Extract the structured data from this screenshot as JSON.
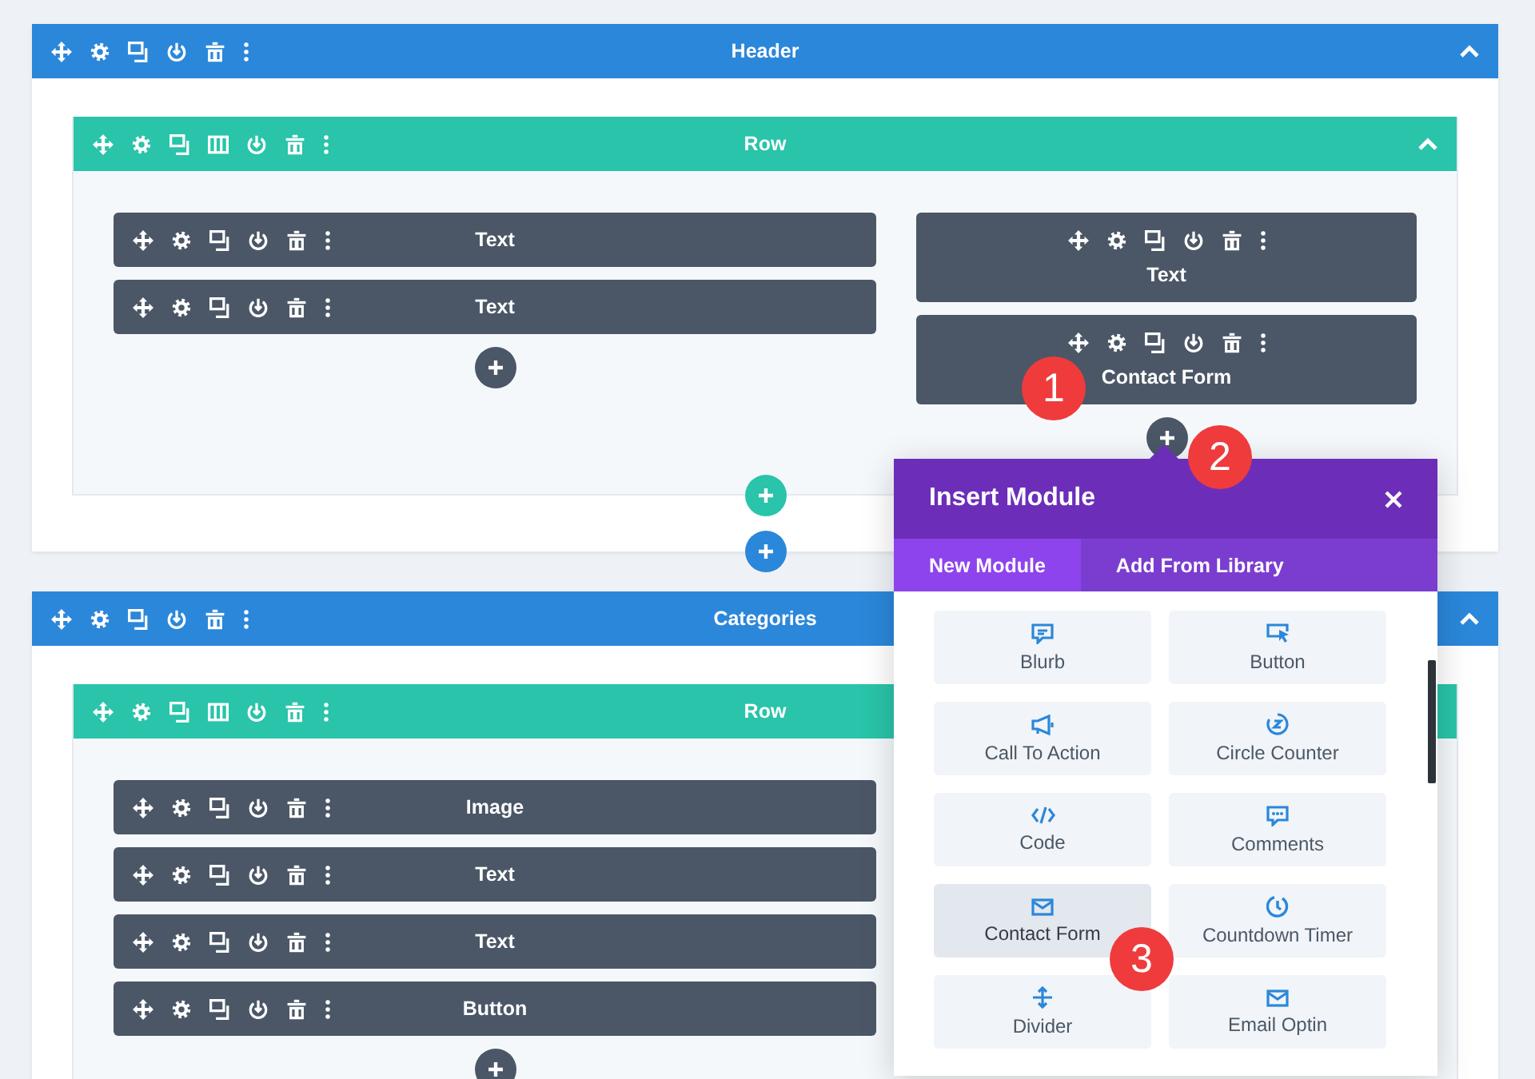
{
  "sections": [
    {
      "title": "Header",
      "rows": [
        {
          "title": "Row",
          "columns": [
            {
              "modules": [
                {
                  "title": "Text",
                  "kind": "inline"
                },
                {
                  "title": "Text",
                  "kind": "inline"
                }
              ]
            },
            {
              "modules": [
                {
                  "title": "Text",
                  "kind": "stacked"
                },
                {
                  "title": "Contact Form",
                  "kind": "stacked"
                }
              ]
            }
          ]
        }
      ]
    },
    {
      "title": "Categories",
      "rows": [
        {
          "title": "Row",
          "columns": [
            {
              "modules": [
                {
                  "title": "Image",
                  "kind": "inline"
                },
                {
                  "title": "Text",
                  "kind": "inline"
                },
                {
                  "title": "Text",
                  "kind": "inline"
                },
                {
                  "title": "Button",
                  "kind": "inline"
                }
              ]
            }
          ]
        }
      ]
    }
  ],
  "popup": {
    "title": "Insert Module",
    "tabs": [
      {
        "label": "New Module",
        "selected": true
      },
      {
        "label": "Add From Library",
        "selected": false
      }
    ],
    "modules": [
      {
        "label": "Blurb",
        "selected": false
      },
      {
        "label": "Button",
        "selected": false
      },
      {
        "label": "Call To Action",
        "selected": false
      },
      {
        "label": "Circle Counter",
        "selected": false
      },
      {
        "label": "Code",
        "selected": false
      },
      {
        "label": "Comments",
        "selected": false
      },
      {
        "label": "Contact Form",
        "selected": true
      },
      {
        "label": "Countdown Timer",
        "selected": false
      },
      {
        "label": "Divider",
        "selected": false
      },
      {
        "label": "Email Optin",
        "selected": false
      }
    ]
  },
  "callouts": [
    {
      "label": "1"
    },
    {
      "label": "2"
    },
    {
      "label": "3"
    }
  ]
}
